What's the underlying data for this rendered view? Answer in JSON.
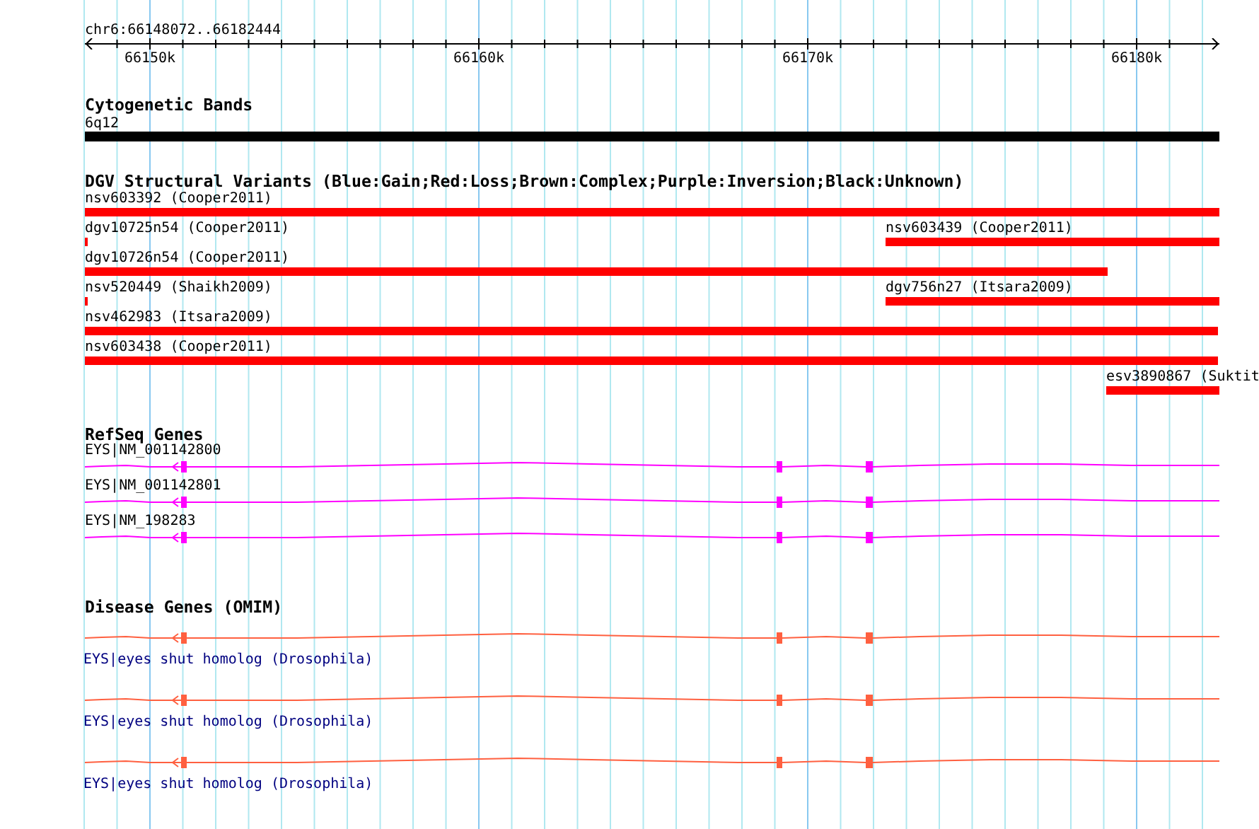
{
  "ruler": {
    "title": "chr6:66148072..66182444",
    "ticks": [
      "66150k",
      "66160k",
      "66170k",
      "66180k"
    ]
  },
  "tracks": [
    {
      "kind": "bands",
      "title": "Cytogenetic Bands",
      "features": [
        {
          "label": "6q12"
        }
      ]
    },
    {
      "kind": "variants",
      "title": "DGV Structural Variants (Blue:Gain;Red:Loss;Brown:Complex;Purple:Inversion;Black:Unknown)",
      "rows": [
        [
          {
            "label": "nsv603392 (Cooper2011)",
            "color": "#ff0000"
          }
        ],
        [
          {
            "label": "dgv10725n54 (Cooper2011)",
            "color": "#ff0000"
          },
          {
            "label": "nsv603439 (Cooper2011)",
            "color": "#ff0000"
          }
        ],
        [
          {
            "label": "dgv10726n54 (Cooper2011)",
            "color": "#ff0000"
          }
        ],
        [
          {
            "label": "nsv520449 (Shaikh2009)",
            "color": "#ff0000"
          },
          {
            "label": "dgv756n27 (Itsara2009)",
            "color": "#ff0000"
          }
        ],
        [
          {
            "label": "nsv462983 (Itsara2009)",
            "color": "#ff0000"
          }
        ],
        [
          {
            "label": "nsv603438 (Cooper2011)",
            "color": "#ff0000"
          }
        ],
        [
          {
            "label": "esv3890867 (Suktit",
            "color": "#ff0000"
          }
        ]
      ]
    },
    {
      "kind": "genes",
      "title": "RefSeq Genes",
      "features": [
        {
          "label": "EYS|NM_001142800"
        },
        {
          "label": "EYS|NM_001142801"
        },
        {
          "label": "EYS|NM_198283"
        }
      ]
    },
    {
      "kind": "disease",
      "title": "Disease Genes (OMIM)",
      "features": [
        {
          "label": "EYS|eyes shut homolog (Drosophila)"
        },
        {
          "label": "EYS|eyes shut homolog (Drosophila)"
        },
        {
          "label": "EYS|eyes shut homolog (Drosophila)"
        }
      ]
    }
  ]
}
